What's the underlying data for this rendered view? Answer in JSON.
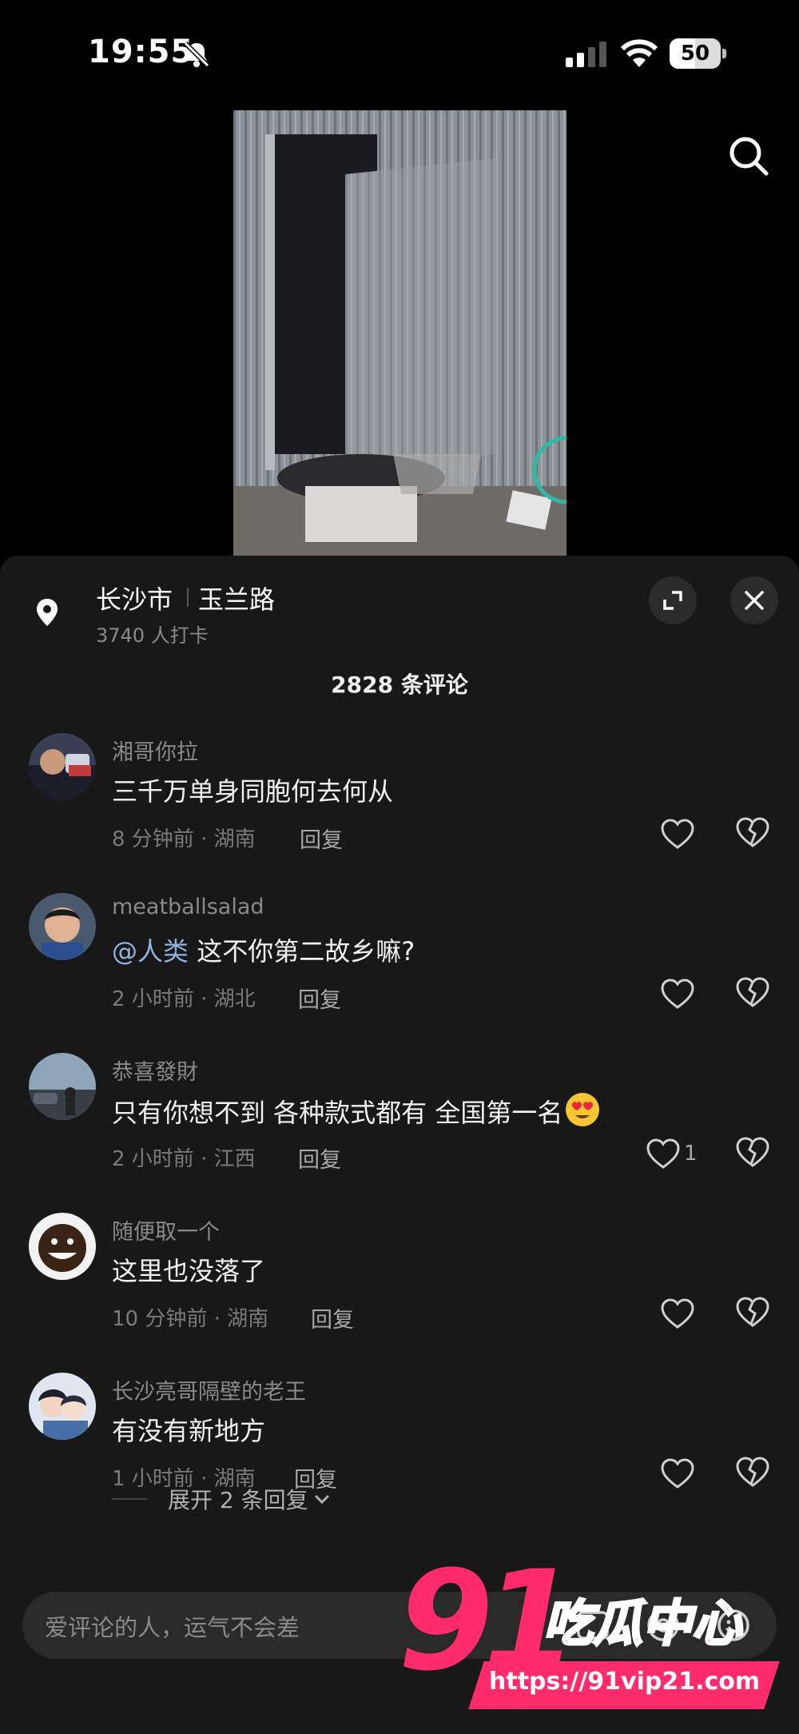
{
  "status": {
    "time": "19:55",
    "battery": "50",
    "battery_level": 50
  },
  "location": {
    "city": "长沙市",
    "road": "玉兰路",
    "checkins": "3740 人打卡"
  },
  "comments_title": "2828 条评论",
  "reply_label": "回复",
  "comments": [
    {
      "user": "湘哥你拉",
      "text": "三千万单身同胞何去何从",
      "meta": "8 分钟前 · 湖南",
      "likes": ""
    },
    {
      "user": "meatballsalad",
      "mention": "@人类",
      "text": " 这不你第二故乡嘛?",
      "meta": "2 小时前 · 湖北",
      "likes": ""
    },
    {
      "user": "恭喜發財",
      "text": "只有你想不到 各种款式都有 全国第一名",
      "meta": "2 小时前 · 江西",
      "likes": "1"
    },
    {
      "user": "随便取一个",
      "text": "这里也没落了",
      "meta": "10 分钟前 · 湖南",
      "likes": ""
    },
    {
      "user": "长沙亮哥隔壁的老王",
      "text": "有没有新地方",
      "meta": "1 小时前 · 湖南",
      "likes": ""
    }
  ],
  "expand_replies": "展开 2 条回复",
  "input": {
    "placeholder": "爱评论的人，运气不会差"
  },
  "watermark": {
    "number": "91",
    "name": "吃瓜中心",
    "url": "https://91vip21.com"
  },
  "icons": [
    "mute-icon",
    "signal-icon",
    "wifi-icon",
    "search-icon",
    "location-pin-icon",
    "expand-icon",
    "close-icon",
    "heart-icon",
    "broken-heart-icon",
    "chevron-down-icon",
    "at-icon",
    "emoji-icon"
  ],
  "colors": {
    "background": "#000000",
    "sheet": "#181818",
    "mention": "#8fb4e0",
    "watermark": "#ff2b6b"
  }
}
